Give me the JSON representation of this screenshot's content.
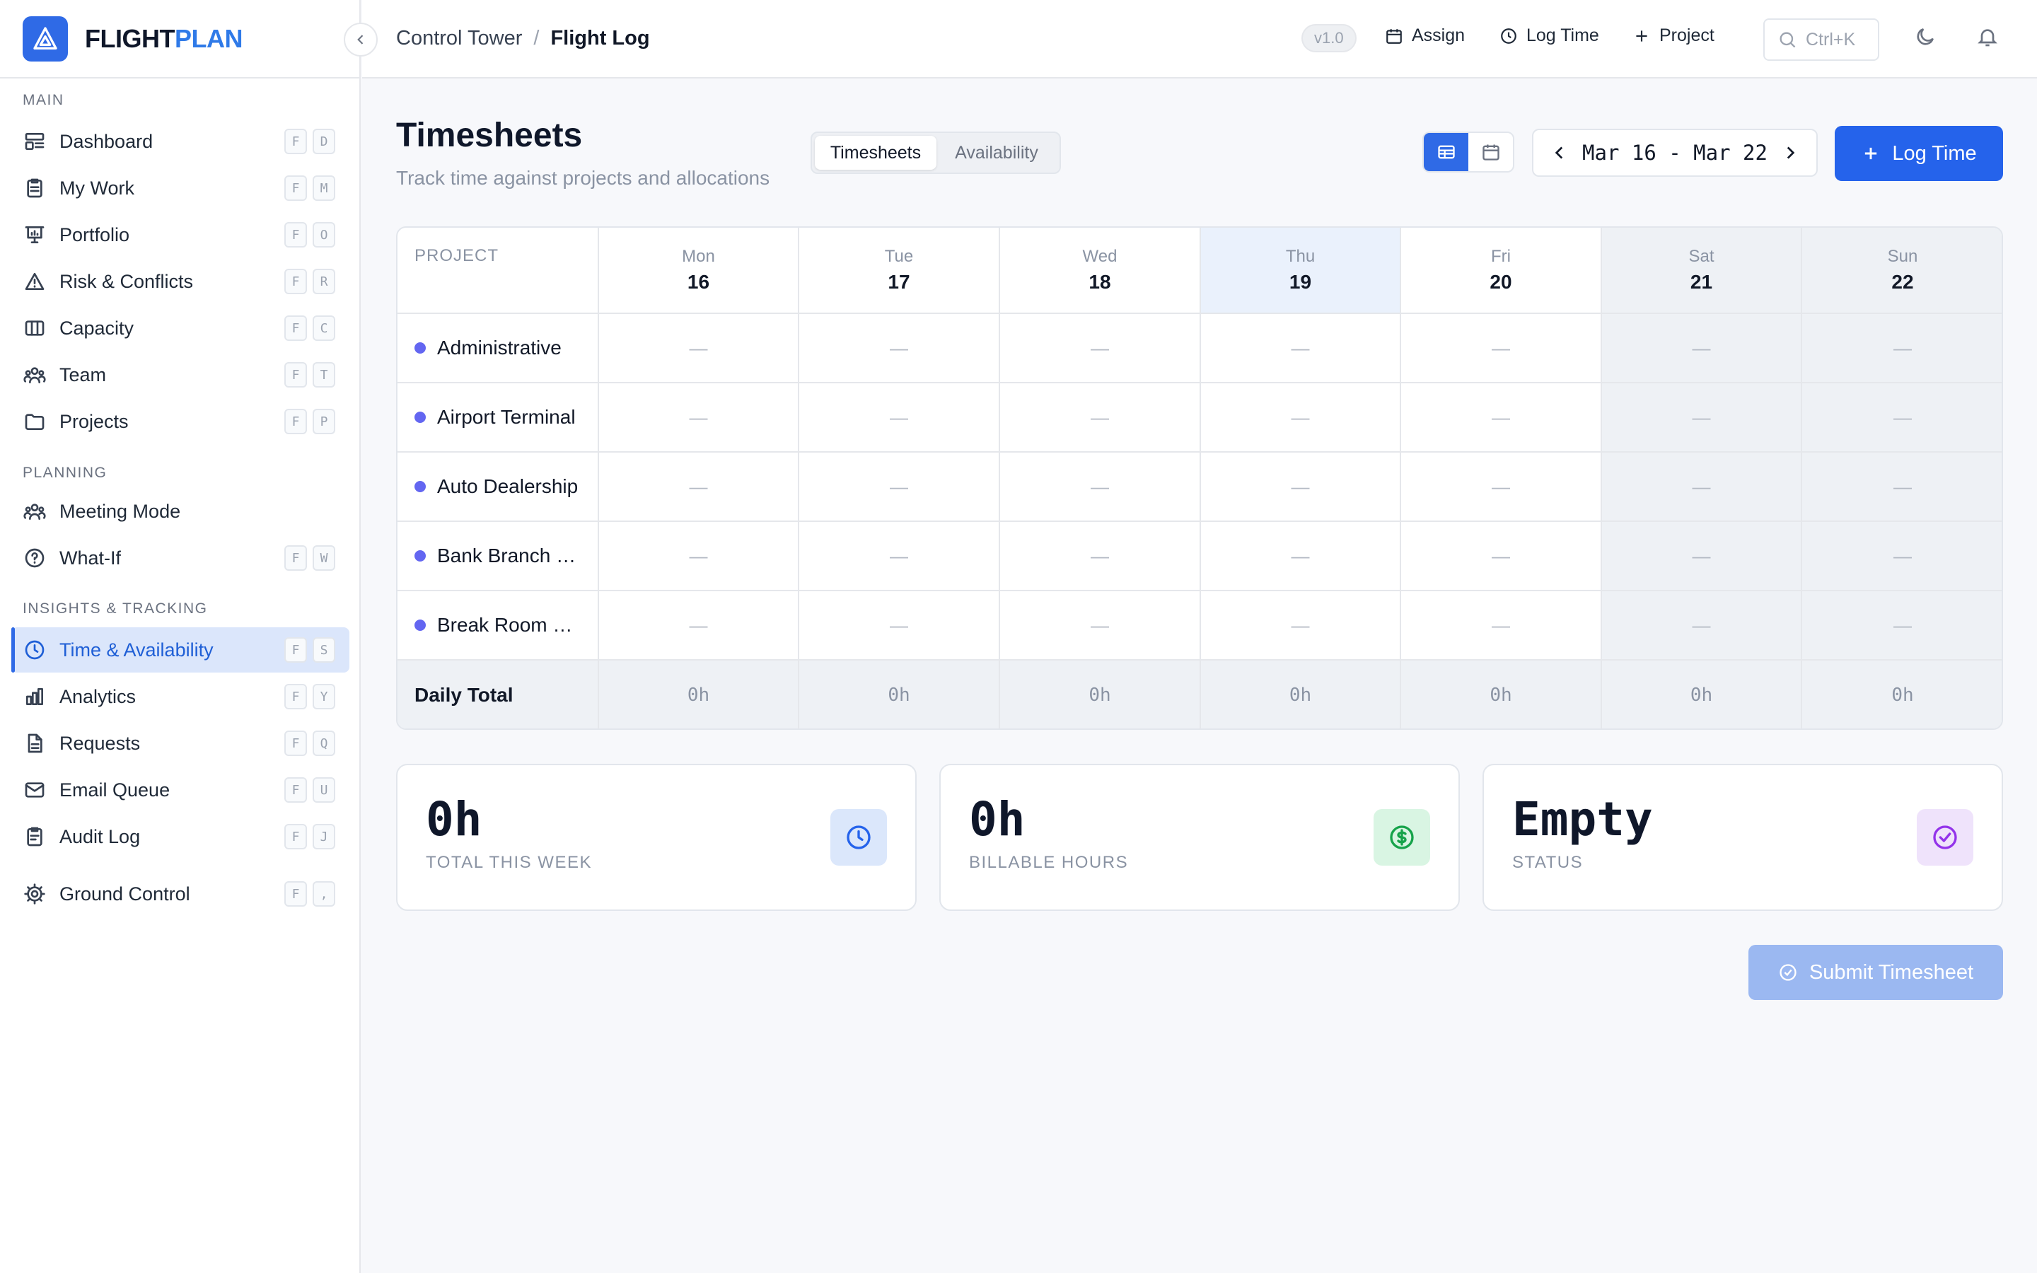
{
  "brand": {
    "part1": "FLIGHT",
    "part2": "PLAN"
  },
  "sidebar": {
    "sections": [
      "MAIN",
      "PLANNING",
      "INSIGHTS & TRACKING"
    ],
    "items": [
      {
        "label": "Dashboard",
        "k1": "F",
        "k2": "D",
        "icon": "dashboard-icon"
      },
      {
        "label": "My Work",
        "k1": "F",
        "k2": "M",
        "icon": "clipboard-icon"
      },
      {
        "label": "Portfolio",
        "k1": "F",
        "k2": "O",
        "icon": "presentation-icon"
      },
      {
        "label": "Risk & Conflicts",
        "k1": "F",
        "k2": "R",
        "icon": "warning-icon"
      },
      {
        "label": "Capacity",
        "k1": "F",
        "k2": "C",
        "icon": "columns-icon"
      },
      {
        "label": "Team",
        "k1": "F",
        "k2": "T",
        "icon": "users-icon"
      },
      {
        "label": "Projects",
        "k1": "F",
        "k2": "P",
        "icon": "folder-icon"
      },
      {
        "label": "Meeting Mode",
        "k1": "",
        "k2": "",
        "icon": "users-icon"
      },
      {
        "label": "What-If",
        "k1": "F",
        "k2": "W",
        "icon": "question-icon"
      },
      {
        "label": "Time & Availability",
        "k1": "F",
        "k2": "S",
        "icon": "clock-icon"
      },
      {
        "label": "Analytics",
        "k1": "F",
        "k2": "Y",
        "icon": "bar-chart-icon"
      },
      {
        "label": "Requests",
        "k1": "F",
        "k2": "Q",
        "icon": "document-icon"
      },
      {
        "label": "Email Queue",
        "k1": "F",
        "k2": "U",
        "icon": "mail-icon"
      },
      {
        "label": "Audit Log",
        "k1": "F",
        "k2": "J",
        "icon": "clipboard-check-icon"
      },
      {
        "label": "Ground Control",
        "k1": "F",
        "k2": ",",
        "icon": "gear-icon"
      }
    ]
  },
  "topbar": {
    "crumb_parent": "Control Tower",
    "crumb_sep": "/",
    "crumb_current": "Flight Log",
    "version": "v1.0",
    "assign": "Assign",
    "log_time": "Log Time",
    "project": "Project",
    "search_hint": "Ctrl+K"
  },
  "page": {
    "title": "Timesheets",
    "subtitle": "Track time against projects and allocations",
    "tab_timesheets": "Timesheets",
    "tab_availability": "Availability",
    "date_range": "Mar 16 - Mar 22",
    "log_time_btn": "Log Time",
    "submit_btn": "Submit Timesheet"
  },
  "table": {
    "project_header": "PROJECT",
    "days": [
      {
        "name": "Mon",
        "num": "16"
      },
      {
        "name": "Tue",
        "num": "17"
      },
      {
        "name": "Wed",
        "num": "18"
      },
      {
        "name": "Thu",
        "num": "19"
      },
      {
        "name": "Fri",
        "num": "20"
      },
      {
        "name": "Sat",
        "num": "21"
      },
      {
        "name": "Sun",
        "num": "22"
      }
    ],
    "rows": [
      {
        "name": "Administrative",
        "cells": [
          "—",
          "—",
          "—",
          "—",
          "—",
          "—",
          "—"
        ]
      },
      {
        "name": "Airport Terminal",
        "cells": [
          "—",
          "—",
          "—",
          "—",
          "—",
          "—",
          "—"
        ]
      },
      {
        "name": "Auto Dealership",
        "cells": [
          "—",
          "—",
          "—",
          "—",
          "—",
          "—",
          "—"
        ]
      },
      {
        "name": "Bank Branch Renovation",
        "cells": [
          "—",
          "—",
          "—",
          "—",
          "—",
          "—",
          "—"
        ]
      },
      {
        "name": "Break Room Remodel",
        "cells": [
          "—",
          "—",
          "—",
          "—",
          "—",
          "—",
          "—"
        ]
      }
    ],
    "total_label": "Daily Total",
    "totals": [
      "0h",
      "0h",
      "0h",
      "0h",
      "0h",
      "0h",
      "0h"
    ]
  },
  "stats": [
    {
      "value": "0h",
      "label": "TOTAL THIS WEEK",
      "icon": "clock-icon",
      "bg": "#dbe7fb",
      "fg": "#2563eb"
    },
    {
      "value": "0h",
      "label": "BILLABLE HOURS",
      "icon": "dollar-icon",
      "bg": "#d9f5e3",
      "fg": "#16a34a"
    },
    {
      "value": "Empty",
      "label": "STATUS",
      "icon": "check-circle-icon",
      "bg": "#efe3fb",
      "fg": "#9333ea"
    }
  ],
  "colors": {
    "accent": "#2563eb",
    "project_dot": "#6366f1"
  }
}
